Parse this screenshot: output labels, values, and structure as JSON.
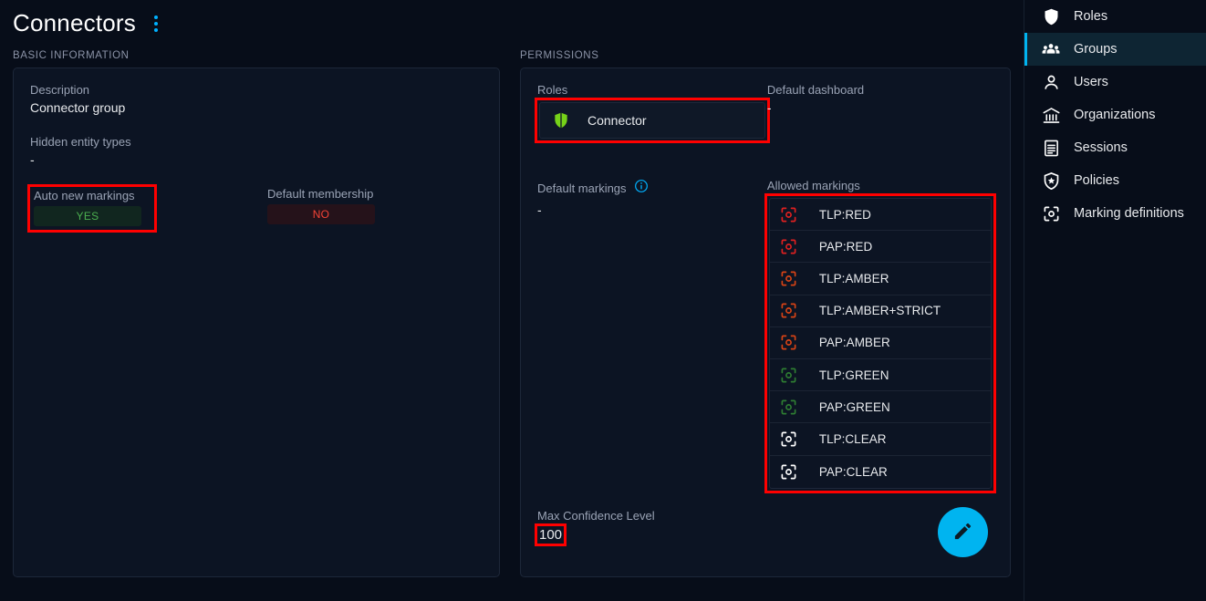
{
  "header": {
    "title": "Connectors",
    "menu_icon": "vertical-dots-icon"
  },
  "sections": {
    "basic_information_label": "BASIC INFORMATION",
    "permissions_label": "PERMISSIONS"
  },
  "basic_information": {
    "description_label": "Description",
    "description_value": "Connector group",
    "hidden_entity_types_label": "Hidden entity types",
    "hidden_entity_types_value": "-",
    "auto_new_markings_label": "Auto new markings",
    "auto_new_markings_value": "YES",
    "default_membership_label": "Default membership",
    "default_membership_value": "NO"
  },
  "permissions": {
    "roles_label": "Roles",
    "role": {
      "name": "Connector",
      "icon": "shield-icon"
    },
    "default_dashboard_label": "Default dashboard",
    "default_dashboard_value": "-",
    "default_markings_label": "Default markings",
    "default_markings_value": "-",
    "default_markings_info_icon": "info-icon",
    "allowed_markings_label": "Allowed markings",
    "allowed_markings": [
      {
        "label": "TLP:RED",
        "color": "#e02020"
      },
      {
        "label": "PAP:RED",
        "color": "#e02020"
      },
      {
        "label": "TLP:AMBER",
        "color": "#d84315"
      },
      {
        "label": "TLP:AMBER+STRICT",
        "color": "#d84315"
      },
      {
        "label": "PAP:AMBER",
        "color": "#d84315"
      },
      {
        "label": "TLP:GREEN",
        "color": "#2e7d32"
      },
      {
        "label": "PAP:GREEN",
        "color": "#2e7d32"
      },
      {
        "label": "TLP:CLEAR",
        "color": "#ffffff"
      },
      {
        "label": "PAP:CLEAR",
        "color": "#ffffff"
      }
    ],
    "max_confidence_label": "Max Confidence Level",
    "max_confidence_value": "100"
  },
  "edit_button": {
    "icon": "pencil-icon",
    "color": "#00b4f0"
  },
  "sidebar": {
    "items": [
      {
        "label": "Roles",
        "icon": "shield-icon",
        "active": false
      },
      {
        "label": "Groups",
        "icon": "group-icon",
        "active": true
      },
      {
        "label": "Users",
        "icon": "person-icon",
        "active": false
      },
      {
        "label": "Organizations",
        "icon": "bank-icon",
        "active": false
      },
      {
        "label": "Sessions",
        "icon": "list-icon",
        "active": false
      },
      {
        "label": "Policies",
        "icon": "shield-star-icon",
        "active": false
      },
      {
        "label": "Marking definitions",
        "icon": "marking-target-icon",
        "active": false
      }
    ],
    "active_color": "#00b4f0"
  }
}
